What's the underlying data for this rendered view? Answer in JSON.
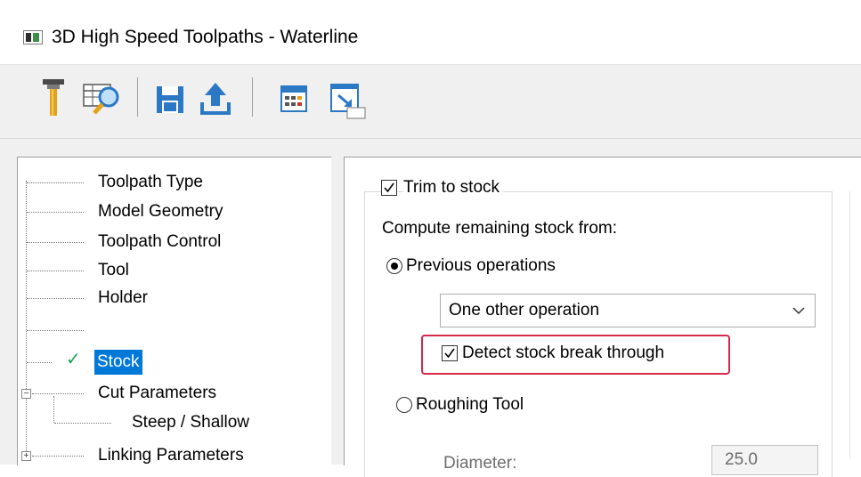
{
  "window": {
    "title": "3D High Speed Toolpaths - Waterline"
  },
  "toolbar": {
    "buttons": [
      {
        "icon": "tool-icon"
      },
      {
        "icon": "tool-database-icon"
      },
      {
        "icon": "save-icon"
      },
      {
        "icon": "export-icon"
      },
      {
        "icon": "calculator-icon"
      },
      {
        "icon": "minimize-dialog-icon"
      }
    ]
  },
  "tree": {
    "items": [
      {
        "label": "Toolpath Type"
      },
      {
        "label": "Model Geometry"
      },
      {
        "label": "Toolpath Control"
      },
      {
        "label": "Tool"
      },
      {
        "label": "Holder"
      },
      {
        "label": ""
      },
      {
        "label": "Stock",
        "selected": true,
        "checked": true
      },
      {
        "label": "Cut Parameters",
        "expander": "−"
      },
      {
        "label": "Steep / Shallow"
      },
      {
        "label": "Linking Parameters",
        "expander": "+"
      }
    ]
  },
  "stock": {
    "trim_label": "Trim to stock",
    "trim_checked": true,
    "compute_label": "Compute remaining stock from:",
    "previous_ops_label": "Previous operations",
    "previous_ops_selected": true,
    "dropdown_value": "One other operation",
    "detect_label": "Detect stock break through",
    "detect_checked": true,
    "roughing_label": "Roughing Tool",
    "roughing_selected": false,
    "diameter_label": "Diameter:",
    "diameter_value": "25.0"
  },
  "colors": {
    "selection": "#0078d7",
    "highlight_border": "#d6284b",
    "check_green": "#1fa35a",
    "toolbar_blue": "#2b78c5"
  }
}
